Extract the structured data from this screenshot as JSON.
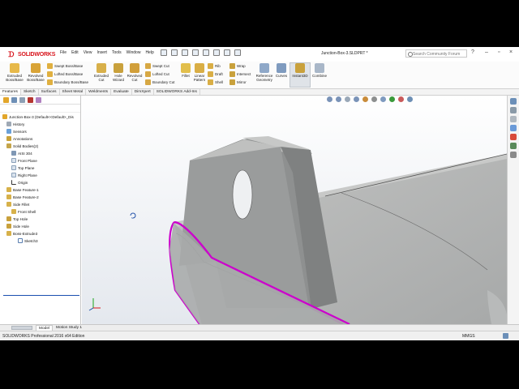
{
  "app": {
    "brand": "SOLIDWORKS",
    "document_title": "Junction-Box-3.SLDPRT *"
  },
  "menu": [
    "File",
    "Edit",
    "View",
    "Insert",
    "Tools",
    "Window",
    "Help"
  ],
  "search": {
    "placeholder": "Search Community Forum"
  },
  "ribbon": {
    "extruded_boss": "Extruded Boss/Base",
    "revolved_boss": "Revolved Boss/Base",
    "swept_boss": "Swept Boss/Base",
    "lofted_boss": "Lofted Boss/Base",
    "boundary_boss": "Boundary Boss/Base",
    "extruded_cut": "Extruded Cut",
    "hole_wizard": "Hole Wizard",
    "revolved_cut": "Revolved Cut",
    "swept_cut": "Swept Cut",
    "lofted_cut": "Lofted Cut",
    "boundary_cut": "Boundary Cut",
    "fillet": "Fillet",
    "linear_pattern": "Linear Pattern",
    "rib": "Rib",
    "draft": "Draft",
    "shell": "Shell",
    "wrap": "Wrap",
    "intersect": "Intersect",
    "mirror": "Mirror",
    "reference_geometry": "Reference Geometry",
    "curves": "Curves",
    "instant3d": "Instant3D",
    "combine": "Combine"
  },
  "command_tabs": [
    "Features",
    "Sketch",
    "Surfaces",
    "Sheet Metal",
    "Weldments",
    "Evaluate",
    "DimXpert",
    "SOLIDWORKS Add-Ins"
  ],
  "active_tab": "Features",
  "tree": {
    "root": "Junction-Box-3 (Default<<Default>_Dis",
    "items": [
      "History",
      "Sensors",
      "Annotations",
      "Solid Bodies(2)",
      "AISI 304",
      "Front Plane",
      "Top Plane",
      "Right Plane",
      "Origin",
      "Base Feature-1",
      "Base Feature-2",
      "Side Fillet",
      "Front Shell",
      "Top Hole",
      "Side Hole",
      "Boss-Extrude3",
      "Sketch3"
    ]
  },
  "bottom_tabs": [
    "Model",
    "Motion Study 1"
  ],
  "status": {
    "left": "SOLIDWORKS Professional 2016 x64 Edition",
    "units": "MMGS"
  },
  "colors": {
    "brand_red": "#d8141c",
    "selection_magenta": "#cc00cc",
    "selection_bar": "#1a4fb0",
    "part_gray": "#a7a9a9"
  },
  "icons": [
    "search-icon",
    "help-icon",
    "rotate-icon",
    "axis-triad-icon"
  ]
}
